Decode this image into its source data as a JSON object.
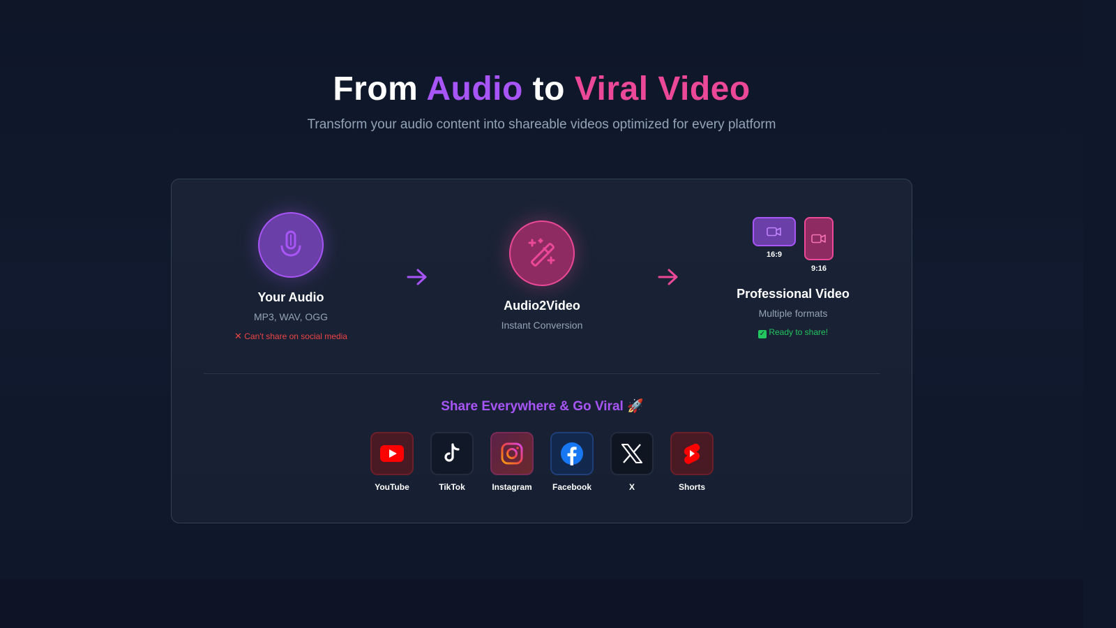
{
  "hero": {
    "title_part1": "From ",
    "title_part2": "Audio",
    "title_part3": " to ",
    "title_part4": "Viral Video",
    "subtitle": "Transform your audio content into shareable videos optimized for every platform"
  },
  "steps": [
    {
      "title": "Your Audio",
      "subtitle": "MP3, WAV, OGG",
      "status": "Can't share on social media",
      "icon": "microphone-icon"
    },
    {
      "title": "Audio2Video",
      "subtitle": "Instant Conversion",
      "icon": "magic-wand-icon"
    },
    {
      "title": "Professional Video",
      "subtitle": "Multiple formats",
      "status": "Ready to share!",
      "icon": "video-camera-icon"
    }
  ],
  "formats": [
    "16:9",
    "9:16"
  ],
  "share": {
    "title": "Share Everywhere & Go Viral",
    "title_emoji": "🚀",
    "platforms": [
      {
        "label": "YouTube",
        "icon": "youtube-icon"
      },
      {
        "label": "TikTok",
        "icon": "tiktok-icon"
      },
      {
        "label": "Instagram",
        "icon": "instagram-icon"
      },
      {
        "label": "Facebook",
        "icon": "facebook-icon"
      },
      {
        "label": "X",
        "icon": "x-icon"
      },
      {
        "label": "Shorts",
        "icon": "youtube-shorts-icon"
      }
    ]
  },
  "colors": {
    "background": "#0f172a",
    "accent_purple": "#a855f7",
    "accent_pink": "#ec4899",
    "muted_text": "#94a3b8",
    "error_red": "#ef4444",
    "success_green": "#22c55e"
  }
}
